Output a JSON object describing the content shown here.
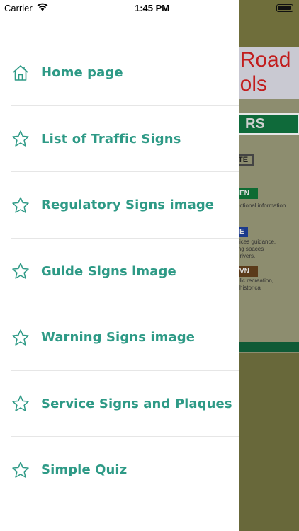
{
  "status_bar": {
    "carrier": "Carrier",
    "time": "1:45 PM"
  },
  "background": {
    "banner_line1": ". Road",
    "banner_line2": "ools",
    "green_bar": "RS",
    "white_box": "TE",
    "tag_green": "EN",
    "tag_green_text": "ectional information.",
    "tag_blue": "E",
    "tag_blue_text": "vices guidance.\ning spaces\ndrivers.",
    "tag_brown": "VN",
    "tag_brown_text": "blic recreation,\nl historical"
  },
  "menu": {
    "items": [
      {
        "label": "Home page",
        "icon": "home-icon"
      },
      {
        "label": "List of Traffic Signs",
        "icon": "star-icon"
      },
      {
        "label": "Regulatory Signs image",
        "icon": "star-icon"
      },
      {
        "label": "Guide Signs image",
        "icon": "star-icon"
      },
      {
        "label": "Warning Signs image",
        "icon": "star-icon"
      },
      {
        "label": "Service Signs and Plaques",
        "icon": "star-icon"
      },
      {
        "label": "Simple Quiz",
        "icon": "star-icon"
      }
    ]
  },
  "colors": {
    "accent": "#2e9a86",
    "divider": "#e6e6e6",
    "dim_background": "#68683a"
  }
}
